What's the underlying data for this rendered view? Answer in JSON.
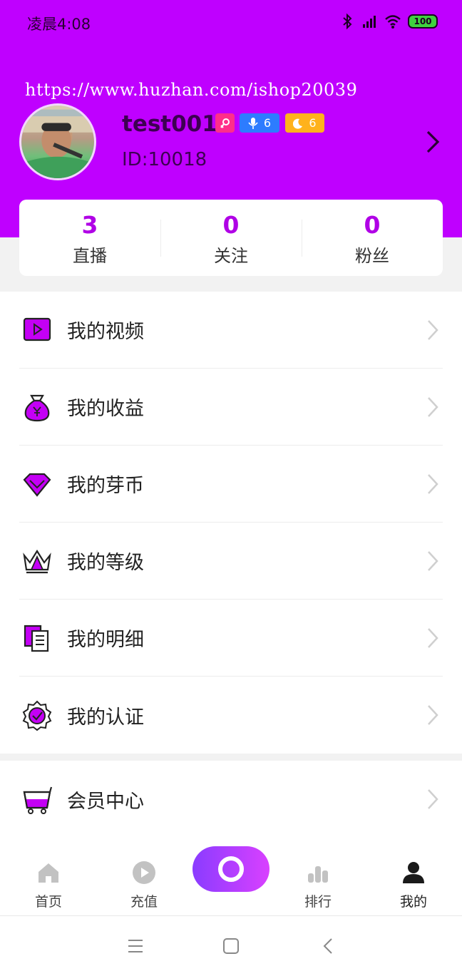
{
  "status_bar": {
    "time": "凌晨4:08",
    "battery": "100"
  },
  "watermark": "https://www.huzhan.com/ishop20039",
  "profile": {
    "username": "test001",
    "user_id": "ID:10018",
    "badges": [
      {
        "type": "gender",
        "icon": "female-symbol-icon",
        "color": "#ff2e8a"
      },
      {
        "type": "anchor-level",
        "icon": "microphone-icon",
        "value": "6",
        "color": "#2d7cff"
      },
      {
        "type": "user-level",
        "icon": "moon-icon",
        "value": "6",
        "color": "#ffb21c"
      }
    ]
  },
  "stats": [
    {
      "value": "3",
      "label": "直播"
    },
    {
      "value": "0",
      "label": "关注"
    },
    {
      "value": "0",
      "label": "粉丝"
    }
  ],
  "menu": [
    {
      "label": "我的视频",
      "icon": "video-icon"
    },
    {
      "label": "我的收益",
      "icon": "money-bag-icon"
    },
    {
      "label": "我的芽币",
      "icon": "diamond-icon"
    },
    {
      "label": "我的等级",
      "icon": "crown-icon"
    },
    {
      "label": "我的明细",
      "icon": "document-icon"
    },
    {
      "label": "我的认证",
      "icon": "verified-badge-icon"
    }
  ],
  "menu2": [
    {
      "label": "会员中心",
      "icon": "cart-icon"
    }
  ],
  "tabs": [
    {
      "label": "首页",
      "icon": "home-icon"
    },
    {
      "label": "充值",
      "icon": "play-circle-icon"
    },
    {
      "label": "排行",
      "icon": "bar-chart-icon"
    },
    {
      "label": "我的",
      "icon": "person-icon",
      "active": true
    }
  ],
  "colors": {
    "brand": "#bf00ff",
    "accent_text": "#b000e6"
  }
}
